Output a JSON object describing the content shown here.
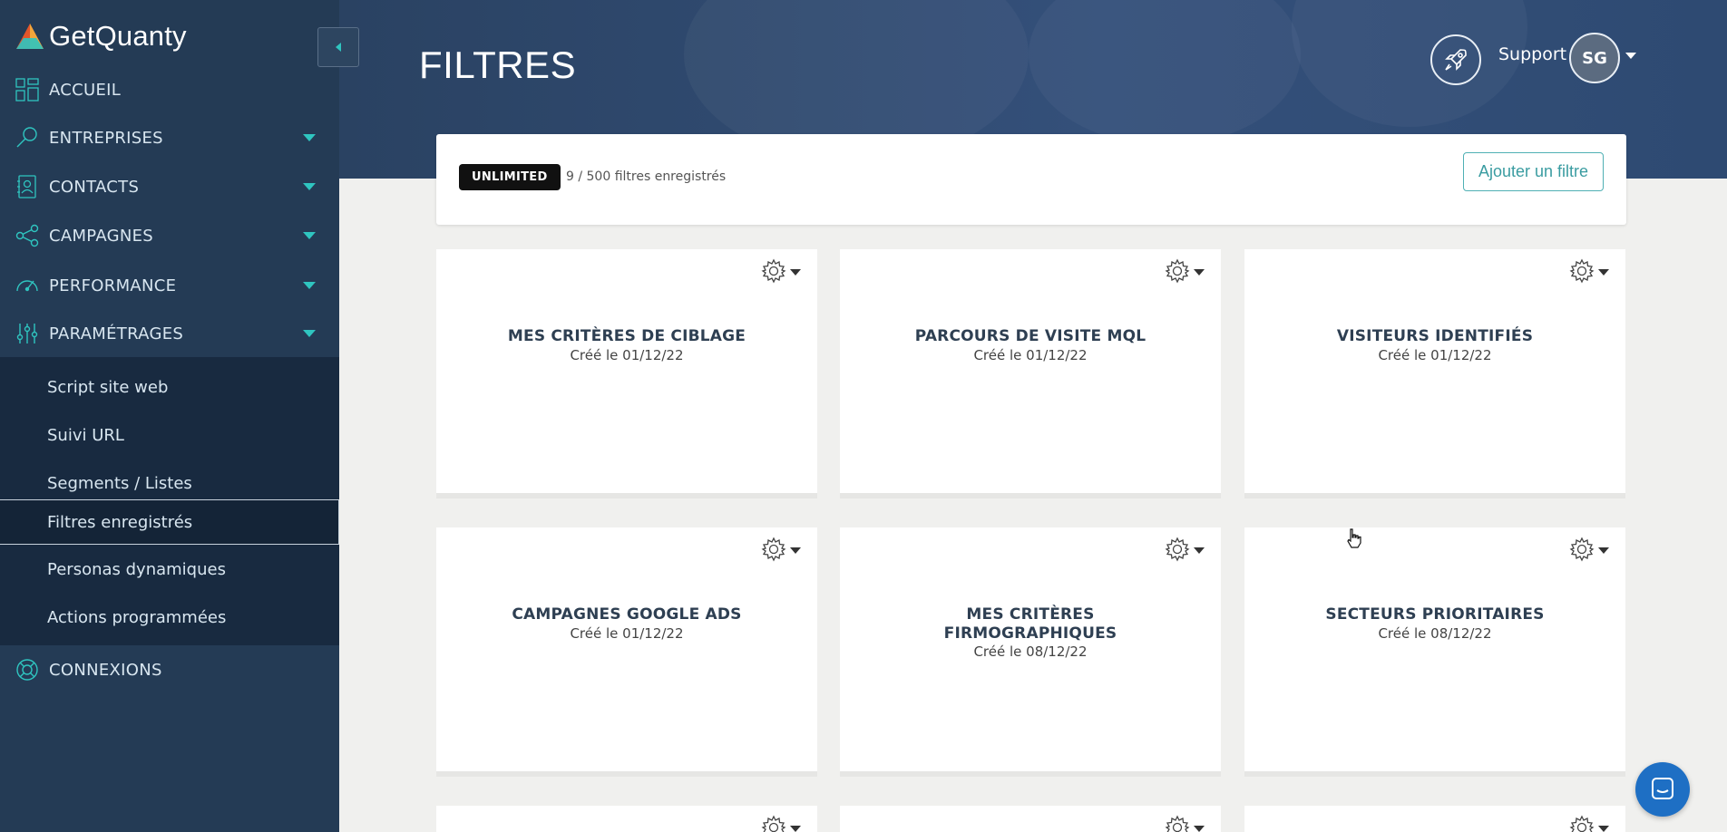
{
  "brand": {
    "name": "GetQuanty"
  },
  "nav": {
    "items": [
      {
        "label": "ACCUEIL",
        "icon": "dashboard-icon",
        "has_caret": false
      },
      {
        "label": "ENTREPRISES",
        "icon": "rocket-search-icon",
        "has_caret": true
      },
      {
        "label": "CONTACTS",
        "icon": "contact-card-icon",
        "has_caret": true
      },
      {
        "label": "CAMPAGNES",
        "icon": "share-nodes-icon",
        "has_caret": true
      },
      {
        "label": "PERFORMANCE",
        "icon": "gauge-icon",
        "has_caret": true
      },
      {
        "label": "PARAMÉTRAGES",
        "icon": "sliders-icon",
        "has_caret": true
      }
    ],
    "submenu": [
      {
        "label": "Script site web"
      },
      {
        "label": "Suivi URL"
      },
      {
        "label": "Segments / Listes"
      },
      {
        "label": "Filtres enregistrés",
        "active": true
      },
      {
        "label": "Personas dynamiques"
      },
      {
        "label": "Actions programmées"
      }
    ],
    "footer_item": {
      "label": "CONNEXIONS",
      "icon": "lifebuoy-icon"
    }
  },
  "header": {
    "title": "FILTRES",
    "support_label": "Support",
    "avatar_initials": "SG"
  },
  "plan": {
    "badge": "UNLIMITED",
    "count_text": "9 / 500 filtres enregistrés",
    "add_button": "Ajouter un filtre"
  },
  "filters": [
    {
      "title": "MES CRITÈRES DE CIBLAGE",
      "date": "Créé le 01/12/22"
    },
    {
      "title": "PARCOURS DE VISITE MQL",
      "date": "Créé le 01/12/22"
    },
    {
      "title": "VISITEURS IDENTIFIÉS",
      "date": "Créé le 01/12/22"
    },
    {
      "title": "CAMPAGNES GOOGLE ADS",
      "date": "Créé le 01/12/22"
    },
    {
      "title": "MES CRITÈRES FIRMOGRAPHIQUES",
      "date": "Créé le 08/12/22"
    },
    {
      "title": "SECTEURS PRIORITAIRES",
      "date": "Créé le 08/12/22"
    }
  ],
  "colors": {
    "sidebar": "#243b55",
    "submenu": "#182a40",
    "accent": "#2fc5c0",
    "chat": "#1e6fc4"
  }
}
